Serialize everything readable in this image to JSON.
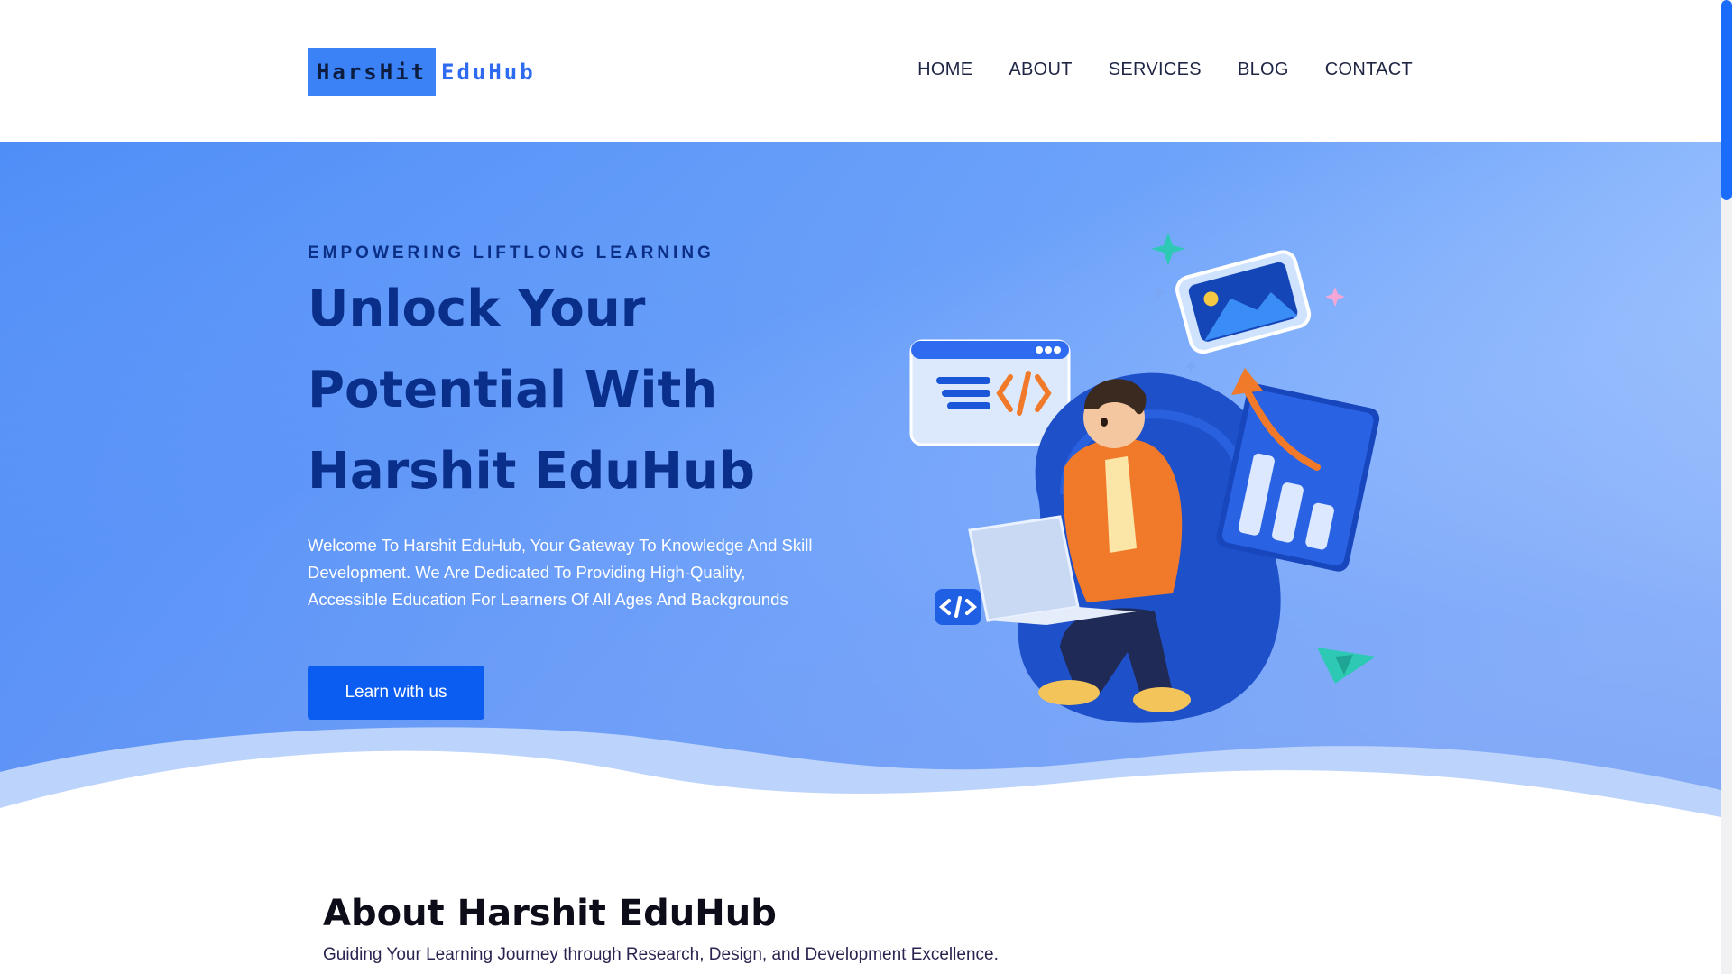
{
  "brand": {
    "logo_box_text": "HarsHit",
    "logo_rest_text": "EduHub",
    "logo_color": "#3b82f6"
  },
  "nav": {
    "items": [
      {
        "label": "HOME"
      },
      {
        "label": "ABOUT"
      },
      {
        "label": "SERVICES"
      },
      {
        "label": "BLOG"
      },
      {
        "label": "CONTACT"
      }
    ]
  },
  "hero": {
    "eyebrow": "EMPOWERING LIFTLONG LEARNING",
    "title": "Unlock Your Potential With Harshit EduHub",
    "description": "Welcome To Harshit EduHub, Your Gateway To Knowledge And Skill Development. We Are Dedicated To Providing High-Quality, Accessible Education For Learners Of All Ages And Backgrounds",
    "cta_label": "Learn with us",
    "illustration": "student-with-laptop-illustration"
  },
  "about": {
    "title": "About Harshit EduHub",
    "subtitle": "Guiding Your Learning Journey through Research, Design, and Development Excellence."
  },
  "colors": {
    "primary": "#0b5cf0",
    "heading": "#0a2f8a",
    "accent_orange": "#f07a2a",
    "accent_teal": "#2ec9b5"
  }
}
